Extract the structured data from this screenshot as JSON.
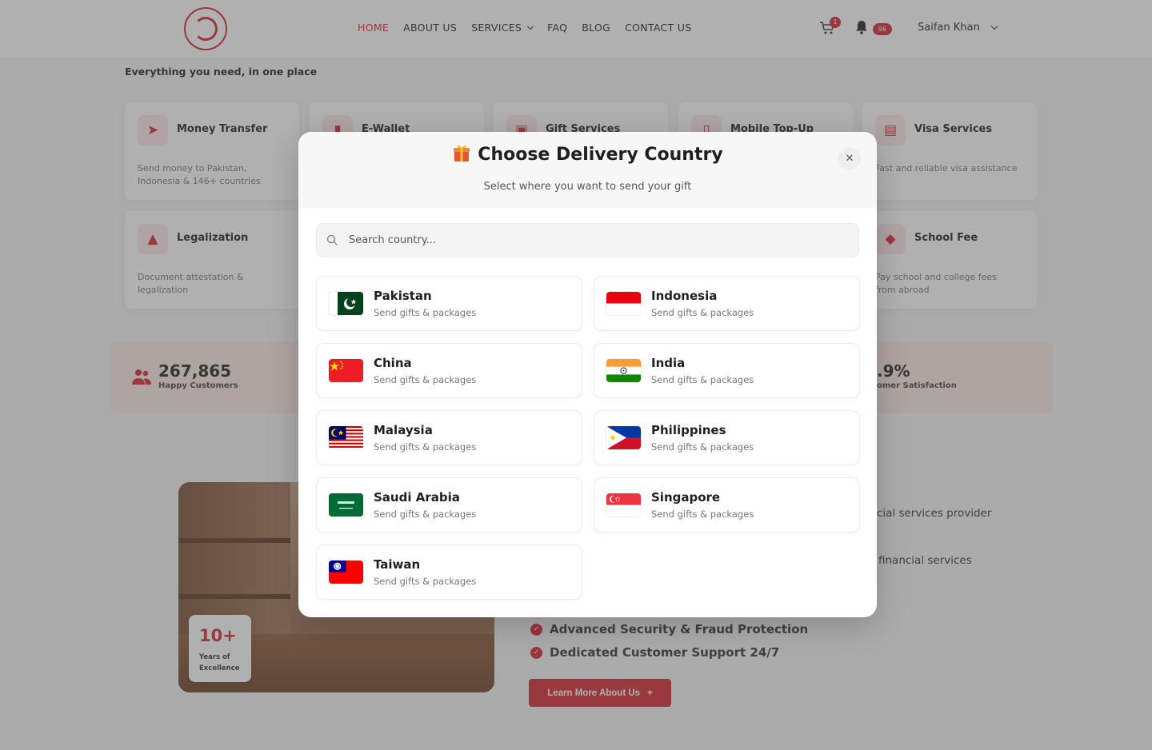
{
  "nav": {
    "items": [
      {
        "label": "HOME",
        "active": true
      },
      {
        "label": "ABOUT US"
      },
      {
        "label": "SERVICES",
        "has_dropdown": true
      },
      {
        "label": "FAQ"
      },
      {
        "label": "BLOG"
      },
      {
        "label": "CONTACT US"
      }
    ],
    "cart_count": "1",
    "notification_count": "96",
    "user_name": "Saifan Khan"
  },
  "page": {
    "tagline": "Everything you need, in one place",
    "services": [
      {
        "title": "Money Transfer",
        "desc": "Send money to Pakistan, Indonesia & 146+ countries"
      },
      {
        "title": "E-Wallet",
        "desc": ""
      },
      {
        "title": "Gift Services",
        "desc": ""
      },
      {
        "title": "Mobile Top-Up",
        "desc": ""
      },
      {
        "title": "Visa Services",
        "desc": "Fast and reliable visa assistance"
      },
      {
        "title": "Legalization",
        "desc": "Document attestation & legalization"
      },
      {
        "title": "School Fee",
        "desc": "Pay school and college fees from abroad"
      }
    ],
    "stats": {
      "customers_number": "267,865",
      "customers_label": "Happy Customers",
      "satisfaction_number": ".9%",
      "satisfaction_label": "omer Satisfaction"
    },
    "about": {
      "years_number": "10+",
      "years_label_1": "Years of",
      "years_label_2": "Excellence",
      "text_1": "cial services provider",
      "text_2": "financial services",
      "features": [
        "Advanced Security & Fraud Protection",
        "Dedicated Customer Support 24/7"
      ],
      "button_label": "Learn More About Us"
    }
  },
  "modal": {
    "title": "Choose Delivery Country",
    "subtitle": "Select where you want to send your gift",
    "search_placeholder": "Search country...",
    "countries": [
      {
        "name": "Pakistan",
        "sub": "Send gifts & packages"
      },
      {
        "name": "Indonesia",
        "sub": "Send gifts & packages"
      },
      {
        "name": "China",
        "sub": "Send gifts & packages"
      },
      {
        "name": "India",
        "sub": "Send gifts & packages"
      },
      {
        "name": "Malaysia",
        "sub": "Send gifts & packages"
      },
      {
        "name": "Philippines",
        "sub": "Send gifts & packages"
      },
      {
        "name": "Saudi Arabia",
        "sub": "Send gifts & packages"
      },
      {
        "name": "Singapore",
        "sub": "Send gifts & packages"
      },
      {
        "name": "Taiwan",
        "sub": "Send gifts & packages"
      }
    ]
  },
  "colors": {
    "accent": "#d6262e",
    "overlay": "rgba(80,80,80,0.45)"
  },
  "icons": [
    "logo",
    "cart-icon",
    "bell-icon",
    "chevron-down-icon",
    "gift-icon",
    "close-icon",
    "search-icon",
    "users-icon",
    "check-icon",
    "plus-icon"
  ]
}
